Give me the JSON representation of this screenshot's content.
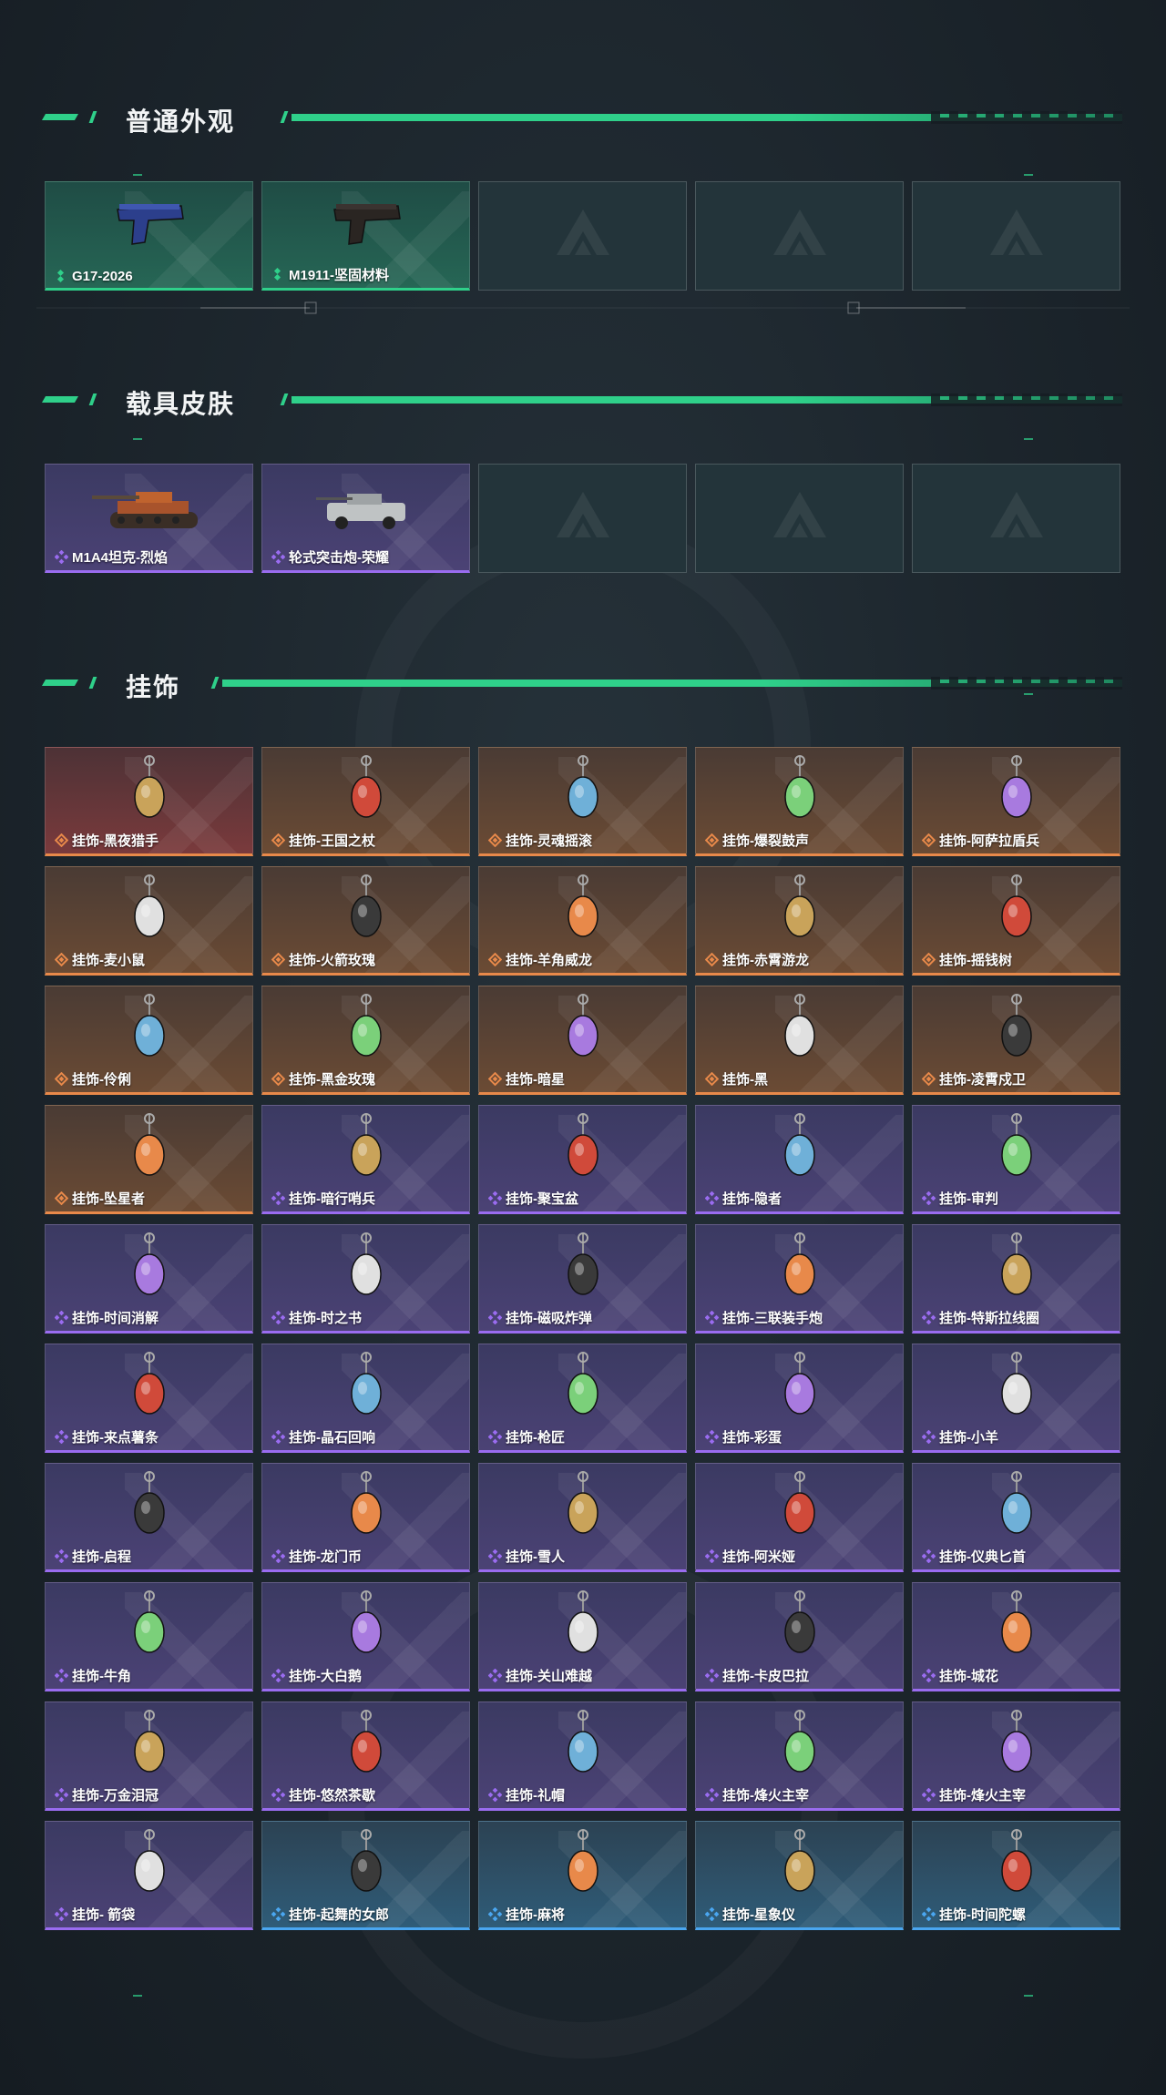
{
  "colors": {
    "accent": "#2fd08a",
    "common": "#2fd08a",
    "epic": "#9a6cf0",
    "legendary": "#e8894a",
    "rare": "#4aa6f0"
  },
  "sections": [
    {
      "title": "普通外观",
      "items": [
        {
          "label": "G17-2026",
          "rarity": "common",
          "icon": "pistol-icon"
        },
        {
          "label": "M1911-坚固材料",
          "rarity": "common",
          "icon": "pistol-icon"
        },
        {
          "label": "",
          "rarity": "empty"
        },
        {
          "label": "",
          "rarity": "empty"
        },
        {
          "label": "",
          "rarity": "empty"
        }
      ]
    },
    {
      "title": "载具皮肤",
      "items": [
        {
          "label": "M1A4坦克-烈焰",
          "rarity": "purple",
          "icon": "tank-icon"
        },
        {
          "label": "轮式突击炮-荣耀",
          "rarity": "purple",
          "icon": "armored-car-icon"
        },
        {
          "label": "",
          "rarity": "empty"
        },
        {
          "label": "",
          "rarity": "empty"
        },
        {
          "label": "",
          "rarity": "empty"
        }
      ]
    },
    {
      "title": "挂饰",
      "items": [
        {
          "label": "挂饰-黑夜猎手",
          "rarity": "red",
          "icon": "charm-icon"
        },
        {
          "label": "挂饰-王国之杖",
          "rarity": "orange",
          "icon": "charm-icon"
        },
        {
          "label": "挂饰-灵魂摇滚",
          "rarity": "orange",
          "icon": "charm-icon"
        },
        {
          "label": "挂饰-爆裂鼓声",
          "rarity": "orange",
          "icon": "charm-icon"
        },
        {
          "label": "挂饰-阿萨拉盾兵",
          "rarity": "orange",
          "icon": "charm-icon"
        },
        {
          "label": "挂饰-麦小鼠",
          "rarity": "orange",
          "icon": "charm-icon"
        },
        {
          "label": "挂饰-火箭玫瑰",
          "rarity": "orange",
          "icon": "charm-icon"
        },
        {
          "label": "挂饰-羊角威龙",
          "rarity": "orange",
          "icon": "charm-icon"
        },
        {
          "label": "挂饰-赤霄游龙",
          "rarity": "orange",
          "icon": "charm-icon"
        },
        {
          "label": "挂饰-摇钱树",
          "rarity": "orange",
          "icon": "charm-icon"
        },
        {
          "label": "挂饰-伶俐",
          "rarity": "orange",
          "icon": "charm-icon"
        },
        {
          "label": "挂饰-黑金玫瑰",
          "rarity": "orange",
          "icon": "charm-icon"
        },
        {
          "label": "挂饰-暗星",
          "rarity": "orange",
          "icon": "charm-icon"
        },
        {
          "label": "挂饰-黑",
          "rarity": "orange",
          "icon": "charm-icon"
        },
        {
          "label": "挂饰-凌霄戍卫",
          "rarity": "orange",
          "icon": "charm-icon"
        },
        {
          "label": "挂饰-坠星者",
          "rarity": "orange",
          "icon": "charm-icon"
        },
        {
          "label": "挂饰-暗行哨兵",
          "rarity": "purple",
          "icon": "charm-icon"
        },
        {
          "label": "挂饰-聚宝盆",
          "rarity": "purple",
          "icon": "charm-icon"
        },
        {
          "label": "挂饰-隐者",
          "rarity": "purple",
          "icon": "charm-icon"
        },
        {
          "label": "挂饰-审判",
          "rarity": "purple",
          "icon": "charm-icon"
        },
        {
          "label": "挂饰-时间消解",
          "rarity": "purple",
          "icon": "charm-icon"
        },
        {
          "label": "挂饰-时之书",
          "rarity": "purple",
          "icon": "charm-icon"
        },
        {
          "label": "挂饰-磁吸炸弹",
          "rarity": "purple",
          "icon": "charm-icon"
        },
        {
          "label": "挂饰-三联装手炮",
          "rarity": "purple",
          "icon": "charm-icon"
        },
        {
          "label": "挂饰-特斯拉线圈",
          "rarity": "purple",
          "icon": "charm-icon"
        },
        {
          "label": "挂饰-来点薯条",
          "rarity": "purple",
          "icon": "charm-icon"
        },
        {
          "label": "挂饰-晶石回响",
          "rarity": "purple",
          "icon": "charm-icon"
        },
        {
          "label": "挂饰-枪匠",
          "rarity": "purple",
          "icon": "charm-icon"
        },
        {
          "label": "挂饰-彩蛋",
          "rarity": "purple",
          "icon": "charm-icon"
        },
        {
          "label": "挂饰-小羊",
          "rarity": "purple",
          "icon": "charm-icon"
        },
        {
          "label": "挂饰-启程",
          "rarity": "purple",
          "icon": "charm-icon"
        },
        {
          "label": "挂饰-龙门币",
          "rarity": "purple",
          "icon": "charm-icon"
        },
        {
          "label": "挂饰-雪人",
          "rarity": "purple",
          "icon": "charm-icon"
        },
        {
          "label": "挂饰-阿米娅",
          "rarity": "purple",
          "icon": "charm-icon"
        },
        {
          "label": "挂饰-仪典匕首",
          "rarity": "purple",
          "icon": "charm-icon"
        },
        {
          "label": "挂饰-牛角",
          "rarity": "purple",
          "icon": "charm-icon"
        },
        {
          "label": "挂饰-大白鹅",
          "rarity": "purple",
          "icon": "charm-icon"
        },
        {
          "label": "挂饰-关山难越",
          "rarity": "purple",
          "icon": "charm-icon"
        },
        {
          "label": "挂饰-卡皮巴拉",
          "rarity": "purple",
          "icon": "charm-icon"
        },
        {
          "label": "挂饰-城花",
          "rarity": "purple",
          "icon": "charm-icon"
        },
        {
          "label": "挂饰-万金泪冠",
          "rarity": "purple",
          "icon": "charm-icon"
        },
        {
          "label": "挂饰-悠然茶歇",
          "rarity": "purple",
          "icon": "charm-icon"
        },
        {
          "label": "挂饰-礼帽",
          "rarity": "purple",
          "icon": "charm-icon"
        },
        {
          "label": "挂饰-烽火主宰",
          "rarity": "purple",
          "icon": "charm-icon"
        },
        {
          "label": "挂饰-烽火主宰",
          "rarity": "purple",
          "icon": "charm-icon"
        },
        {
          "label": "挂饰- 箭袋",
          "rarity": "purple",
          "icon": "charm-icon"
        },
        {
          "label": "挂饰-起舞的女郎",
          "rarity": "blue",
          "icon": "charm-icon"
        },
        {
          "label": "挂饰-麻将",
          "rarity": "blue",
          "icon": "charm-icon"
        },
        {
          "label": "挂饰-星象仪",
          "rarity": "blue",
          "icon": "charm-icon"
        },
        {
          "label": "挂饰-时间陀螺",
          "rarity": "blue",
          "icon": "charm-icon"
        }
      ]
    }
  ]
}
